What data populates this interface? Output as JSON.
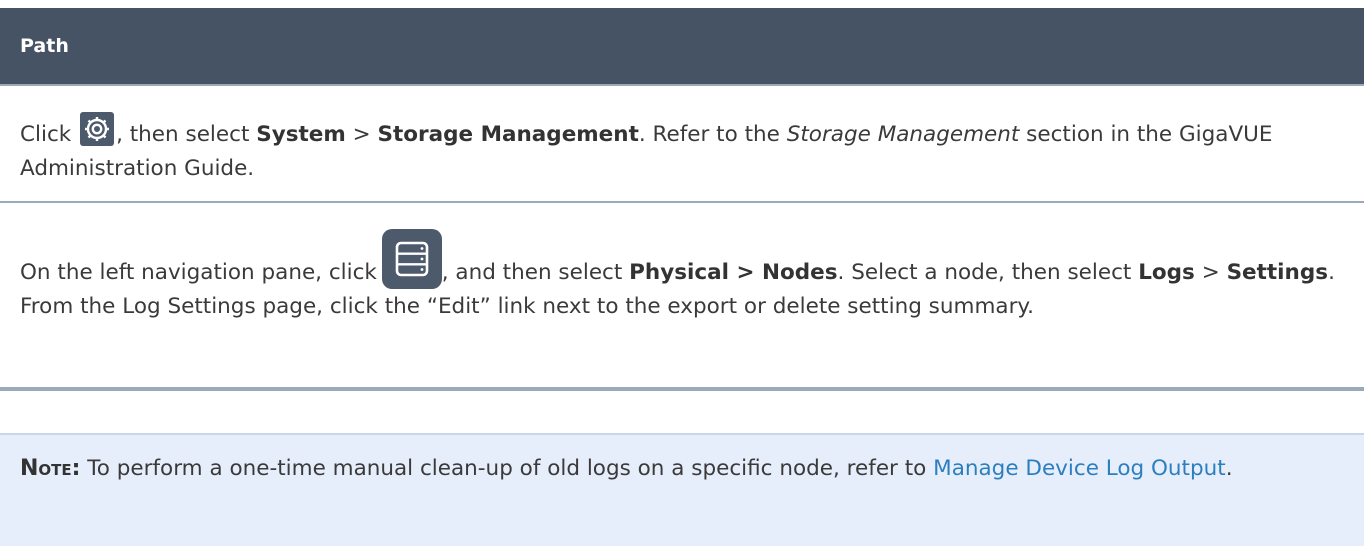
{
  "table": {
    "header": "Path",
    "row1": {
      "click": "Click",
      "t1": ", then select",
      "system": "System",
      "gt1": ">",
      "storage": "Storage Management",
      "t2": ". Refer to the",
      "section_ital": "Storage Management",
      "t3": "section in the GigaVUE Administration Guide."
    },
    "row2": {
      "t1": "On the left navigation pane, click",
      "t2": ", and then select",
      "physical": "Physical > Nodes",
      "t3": ". Select a node, then select",
      "logs": "Logs",
      "gt": ">",
      "settings": "Settings",
      "t4": ". From the Log Settings page, click the “Edit” link next to the export or delete setting summary."
    }
  },
  "note": {
    "label": "Note:",
    "text": "To perform a one-time manual clean-up of old logs on a specific node, refer to",
    "link": "Manage Device Log Output",
    "end": "."
  },
  "icons": {
    "gear": "gear-icon",
    "nav": "server-list-icon"
  },
  "colors": {
    "header_bg": "#465365",
    "note_bg": "#e7eefb",
    "link": "#2c7fbf",
    "icon_bg": "#4d5a6c"
  }
}
